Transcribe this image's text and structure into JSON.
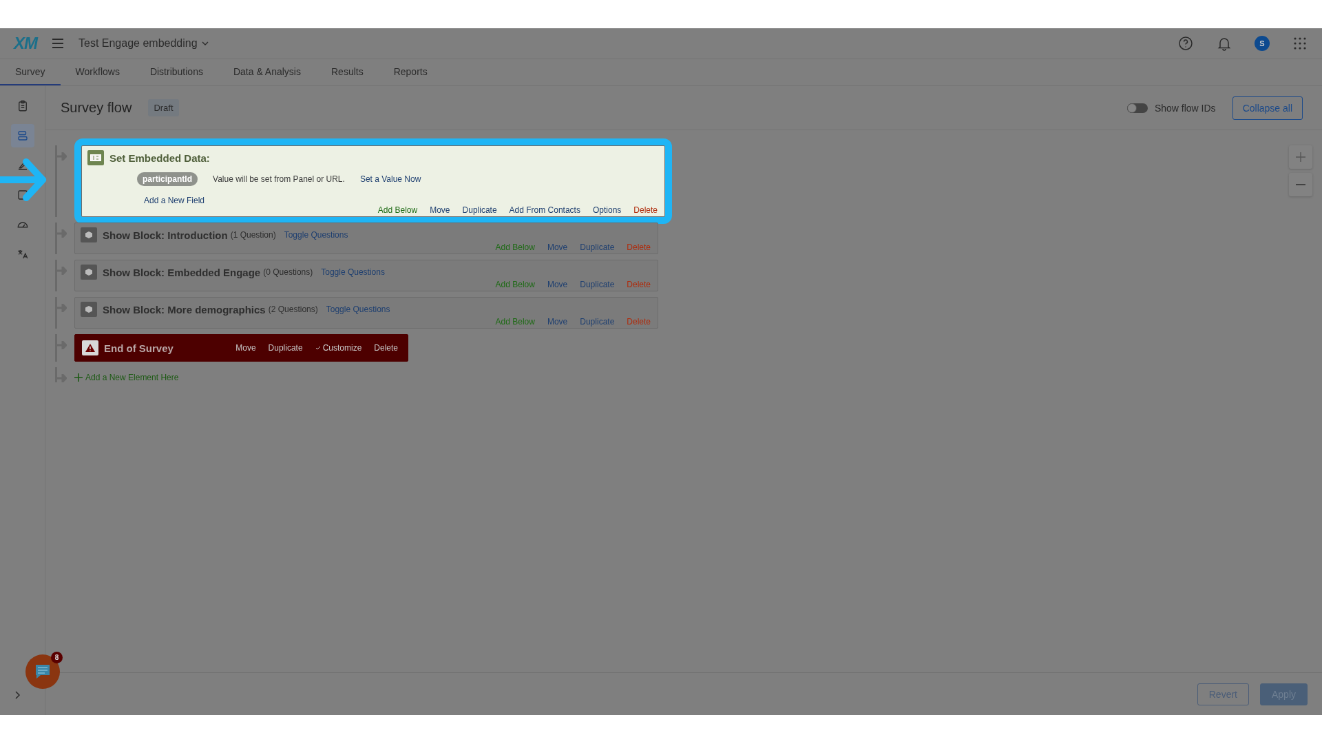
{
  "header": {
    "logo": "XM",
    "project_title": "Test Engage embedding",
    "avatar": "S"
  },
  "tabs": [
    {
      "label": "Survey",
      "selected": true
    },
    {
      "label": "Workflows",
      "selected": false
    },
    {
      "label": "Distributions",
      "selected": false
    },
    {
      "label": "Data & Analysis",
      "selected": false
    },
    {
      "label": "Results",
      "selected": false
    },
    {
      "label": "Reports",
      "selected": false
    }
  ],
  "sidebar": {
    "items": [
      {
        "kind": "clipboard",
        "selected": false
      },
      {
        "kind": "flow",
        "selected": true
      },
      {
        "kind": "brush",
        "selected": false
      },
      {
        "kind": "square",
        "selected": false
      },
      {
        "kind": "gauge",
        "selected": false
      },
      {
        "kind": "translate",
        "selected": false
      }
    ]
  },
  "page": {
    "title": "Survey flow",
    "status": "Draft",
    "toggle": {
      "label": "Show flow IDs",
      "on": false
    },
    "collapse_button": "Collapse all"
  },
  "flow": [
    {
      "kind": "embedded_data",
      "highlighted": true,
      "title": "Set Embedded Data:",
      "fields": [
        {
          "name": "participantId",
          "text": "Value will be set from Panel or URL.",
          "link": "Set a Value Now"
        }
      ],
      "add_field": "Add a New Field",
      "actions": [
        {
          "kind": "add",
          "label": "Add Below"
        },
        {
          "kind": "normal",
          "label": "Move"
        },
        {
          "kind": "normal",
          "label": "Duplicate"
        },
        {
          "kind": "normal",
          "label": "Add From Contacts"
        },
        {
          "kind": "normal",
          "label": "Options"
        },
        {
          "kind": "delete",
          "label": "Delete"
        }
      ]
    },
    {
      "kind": "block",
      "highlighted": false,
      "title": "Show Block: Introduction",
      "count": "(1 Question)",
      "toggle": "Toggle Questions",
      "actions": [
        {
          "kind": "add",
          "label": "Add Below"
        },
        {
          "kind": "normal",
          "label": "Move"
        },
        {
          "kind": "normal",
          "label": "Duplicate"
        },
        {
          "kind": "delete",
          "label": "Delete"
        }
      ]
    },
    {
      "kind": "block",
      "highlighted": false,
      "title": "Show Block: Embedded Engage",
      "count": "(0 Questions)",
      "toggle": "Toggle Questions",
      "actions": [
        {
          "kind": "add",
          "label": "Add Below"
        },
        {
          "kind": "normal",
          "label": "Move"
        },
        {
          "kind": "normal",
          "label": "Duplicate"
        },
        {
          "kind": "delete",
          "label": "Delete"
        }
      ]
    },
    {
      "kind": "block",
      "highlighted": false,
      "title": "Show Block: More demographics",
      "count": "(2 Questions)",
      "toggle": "Toggle Questions",
      "actions": [
        {
          "kind": "add",
          "label": "Add Below"
        },
        {
          "kind": "normal",
          "label": "Move"
        },
        {
          "kind": "normal",
          "label": "Duplicate"
        },
        {
          "kind": "delete",
          "label": "Delete"
        }
      ]
    },
    {
      "kind": "end",
      "highlighted": false,
      "title": "End of Survey",
      "actions": [
        {
          "kind": "normal",
          "label": "Move"
        },
        {
          "kind": "normal",
          "label": "Duplicate"
        },
        {
          "kind": "check",
          "label": "Customize"
        },
        {
          "kind": "normal",
          "label": "Delete"
        }
      ]
    }
  ],
  "add_element": "Add a New Element Here",
  "footer": {
    "buttons": [
      {
        "kind": "outline",
        "label": "Revert"
      },
      {
        "kind": "primary",
        "label": "Apply"
      }
    ]
  },
  "chat": {
    "badge": "8"
  }
}
